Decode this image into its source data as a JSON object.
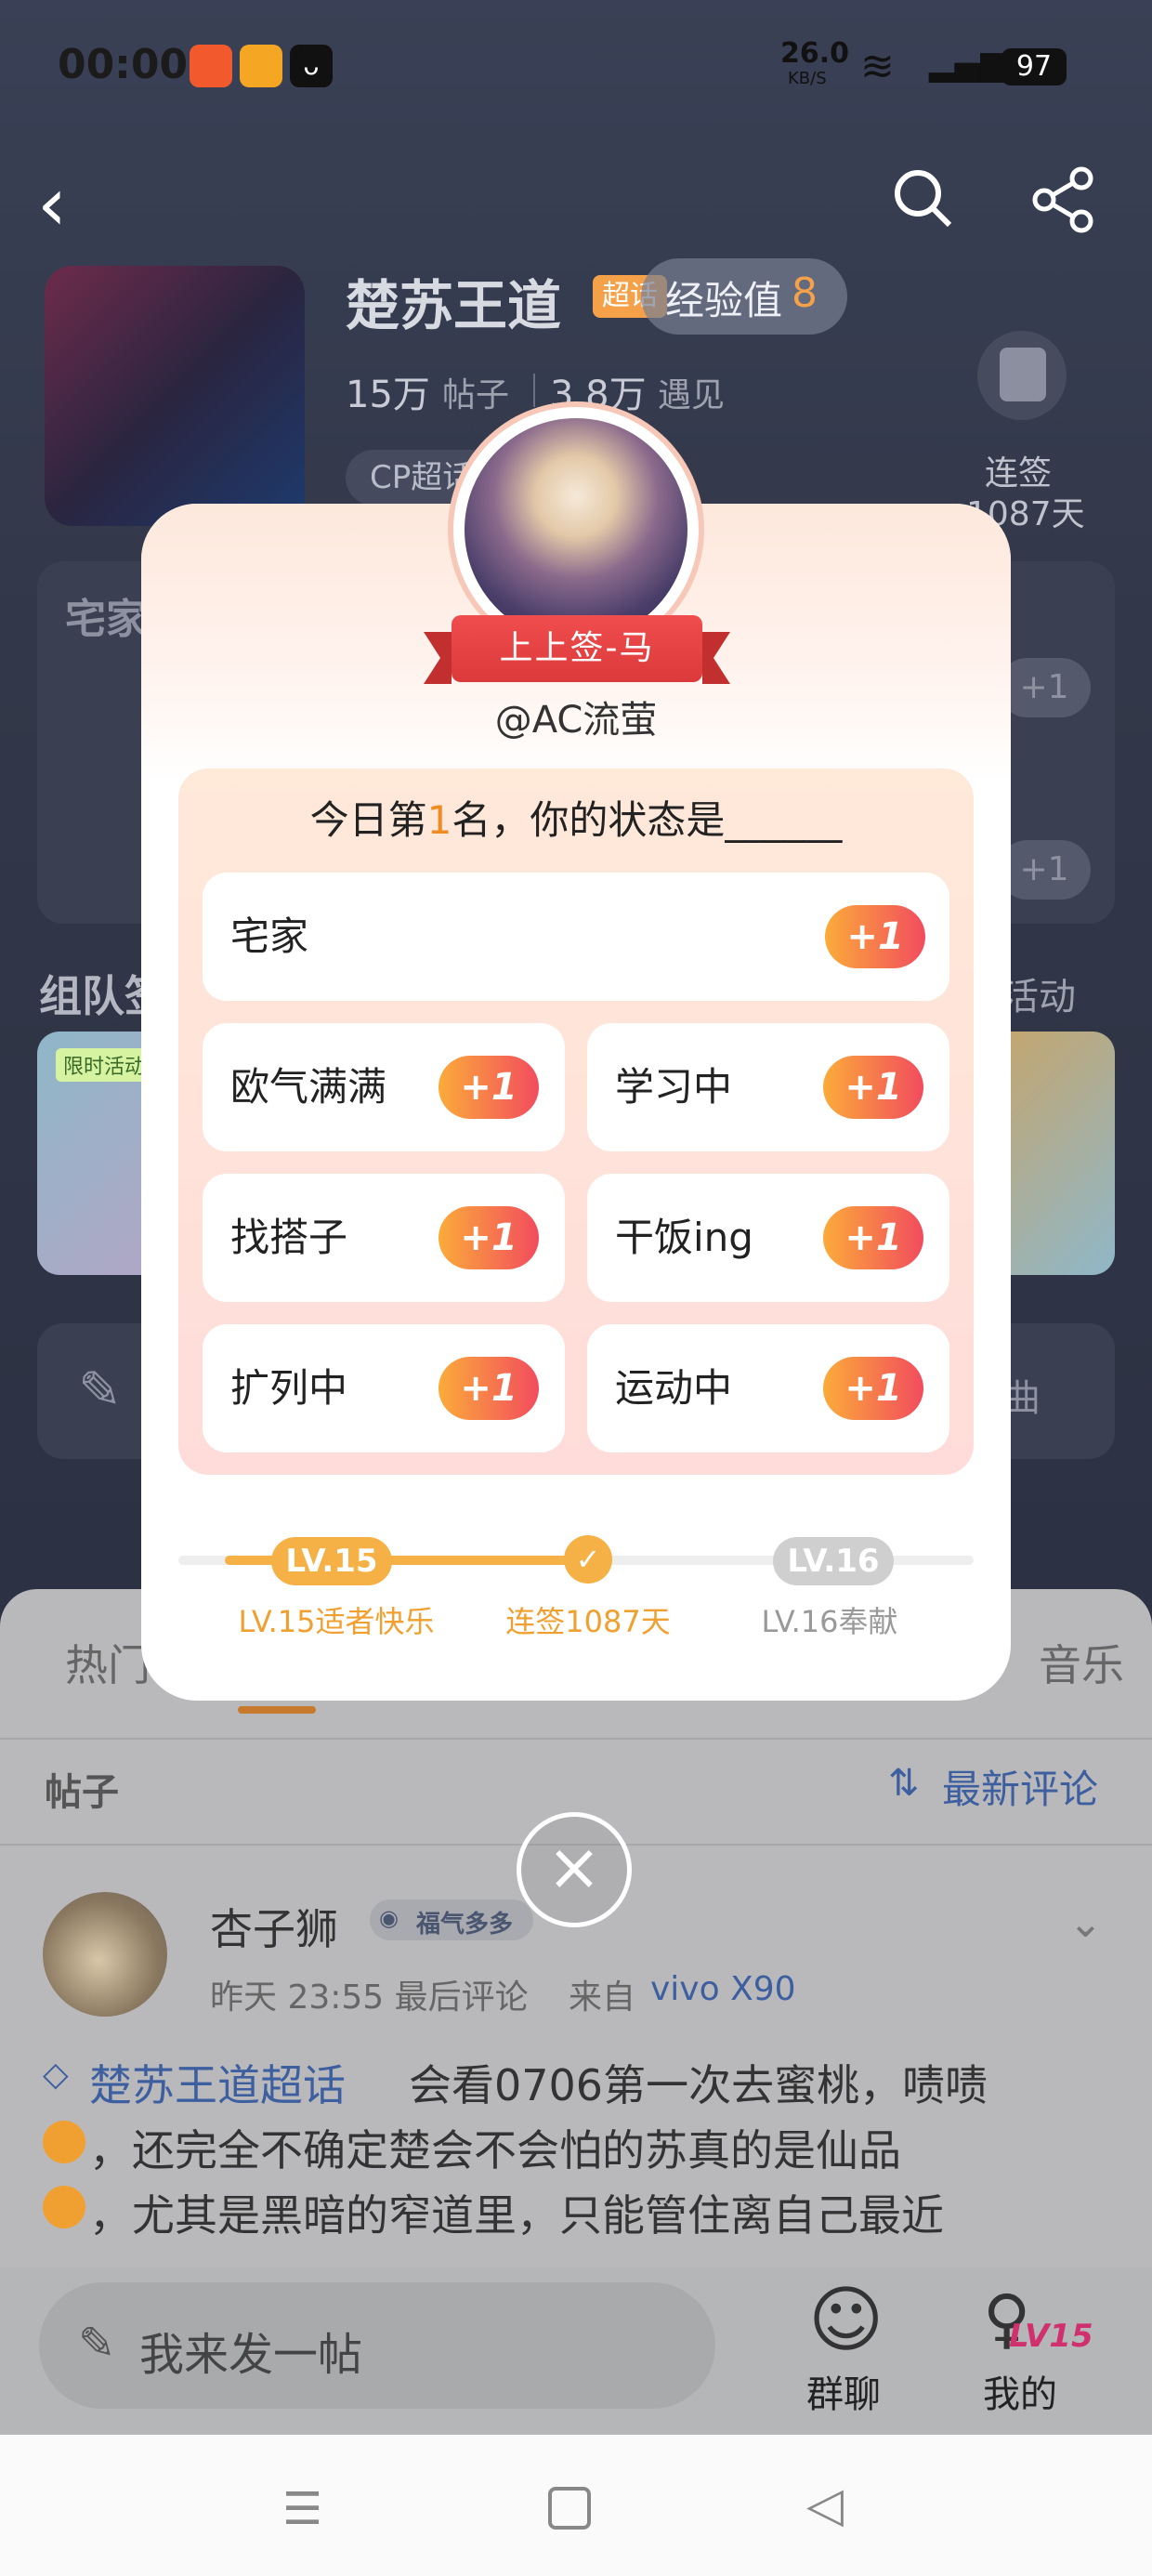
{
  "status_bar": {
    "time": "00:00",
    "net_speed": "26.0",
    "net_unit": "KB/S",
    "battery": "97"
  },
  "community": {
    "name": "楚苏王道",
    "badge": "超话",
    "exp_label": "经验值",
    "exp_value": "8",
    "posts_count": "15万",
    "posts_label": "帖子",
    "meet_count": "3.8万",
    "meet_label": "遇见",
    "tag": "CP超话",
    "checkin_label": "连签",
    "checkin_days": "1087天"
  },
  "background_fragments": {
    "section_left": "宅家",
    "team_section": "组队签",
    "activity_link": "活动",
    "limited_tag": "限时活动",
    "plus_one": "+1",
    "music_tab_partial": "音乐",
    "tab_hot_partial": "热门",
    "music_partial": "曲"
  },
  "popup": {
    "ribbon": "上上签-马",
    "username": "@AC流萤",
    "prompt_prefix": "今日第",
    "rank": "1",
    "prompt_suffix": "名，你的状态是______",
    "plus_label": "+1",
    "options": [
      "宅家",
      "欧气满满",
      "学习中",
      "找搭子",
      "干饭ing",
      "扩列中",
      "运动中"
    ],
    "level_current": "LV.15",
    "level_next": "LV.16",
    "level_current_caption": "LV.15适者快乐",
    "checkin_caption": "连签1087天",
    "level_next_caption": "LV.16奉献",
    "close_icon": "×"
  },
  "posts": {
    "section_title": "帖子",
    "sort_label": "最新评论",
    "author": "杏子狮",
    "author_badge": "福气多多",
    "time": "昨天 23:55 最后评论",
    "source_prefix": "来自",
    "device": "vivo X90",
    "topic_link": "楚苏王道超话",
    "line1": "会看0706第一次去蜜桃，啧啧",
    "line2": "，还完全不确定楚会不会怕的苏真的是仙品",
    "line3": "，尤其是黑暗的窄道里，只能管住离自己最近"
  },
  "bottom": {
    "compose_placeholder": "我来发一帖",
    "group_chat": "群聊",
    "mine": "我的",
    "mine_level": "LV15"
  },
  "colors": {
    "accent_orange": "#f6b146",
    "plus_gradient_start": "#fbab3a",
    "plus_gradient_end": "#f24c5e",
    "ribbon_red": "#e04545"
  }
}
